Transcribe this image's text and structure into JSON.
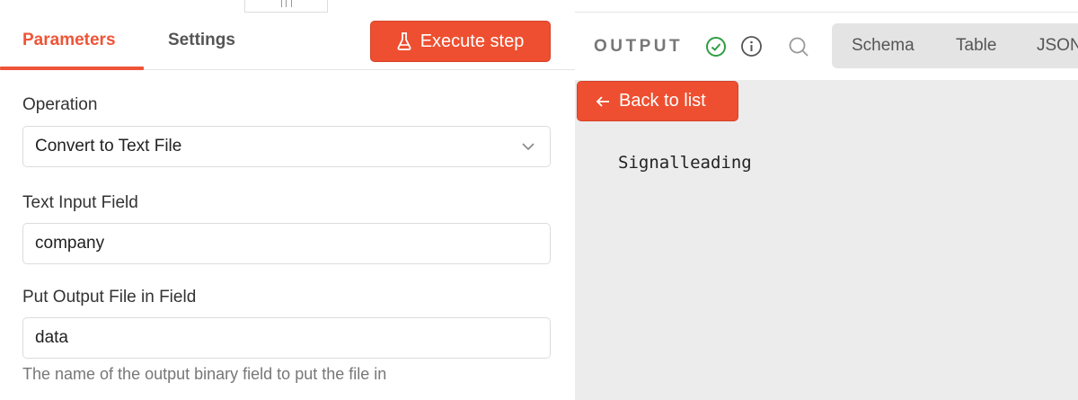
{
  "colors": {
    "accent": "#ee4f30",
    "success": "#2f9e44",
    "panel_bg": "#ececec"
  },
  "left_panel": {
    "tabs": [
      {
        "label": "Parameters",
        "active": true
      },
      {
        "label": "Settings",
        "active": false
      }
    ],
    "execute_button": {
      "label": "Execute step",
      "icon": "flask-icon"
    },
    "fields": {
      "operation": {
        "label": "Operation",
        "value": "Convert to Text File",
        "icon": "chevron-down-icon"
      },
      "text_input": {
        "label": "Text Input Field",
        "value": "company"
      },
      "output_field": {
        "label": "Put Output File in Field",
        "value": "data",
        "helper": "The name of the output binary field to put the file in"
      }
    }
  },
  "right_panel": {
    "title": "OUTPUT",
    "icons": [
      "check-circle-icon",
      "info-icon",
      "search-icon"
    ],
    "view_tabs": [
      "Schema",
      "Table",
      "JSON"
    ],
    "back_button": {
      "label": "Back to list",
      "icon": "arrow-left-icon"
    },
    "file_content": "Signalleading"
  }
}
